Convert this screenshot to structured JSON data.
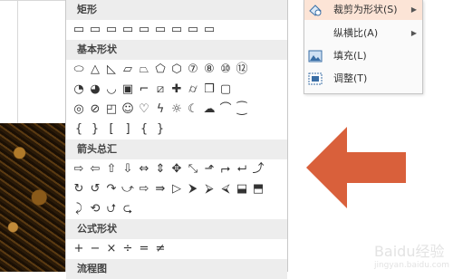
{
  "shape_panel": {
    "categories": {
      "rect": "矩形",
      "basic": "基本形状",
      "arrows": "箭头总汇",
      "equation": "公式形状",
      "flowchart": "流程图"
    },
    "rect_row": [
      "▭",
      "▭",
      "▭",
      "▭",
      "▭",
      "▭",
      "▭",
      "▭",
      "▭"
    ],
    "basic_row1": [
      "⬭",
      "△",
      "◺",
      "▱",
      "⏢",
      "⬠",
      "⬡",
      "⑦",
      "⑧",
      "⑩",
      "⑫"
    ],
    "basic_row2": [
      "◔",
      "◕",
      "◡",
      "▣",
      "⌐",
      "⧄",
      "✚",
      "⌭",
      "❒",
      "▢"
    ],
    "basic_row3": [
      "◎",
      "⊘",
      "◰",
      "☺",
      "♡",
      "ϟ",
      "☼",
      "☾",
      "☁",
      "⌒",
      "⁐"
    ],
    "basic_row4": [
      "{",
      "}",
      "[",
      "]",
      "{",
      "}"
    ],
    "arrows_row1": [
      "⇨",
      "⇦",
      "⇧",
      "⇩",
      "⇔",
      "⇕",
      "✥",
      "⤡",
      "⬏",
      "⮣",
      "⮠",
      "⤴"
    ],
    "arrows_row2": [
      "↻",
      "↺",
      "↷",
      "⤻",
      "⇨",
      "⇛",
      "▷",
      "⮞",
      "⮚",
      "⮘",
      "⬓",
      "⬒"
    ],
    "arrows_row3": [
      "⤸",
      "⟲",
      "⮍",
      "⮎"
    ],
    "equation_row": [
      "+",
      "−",
      "×",
      "÷",
      "=",
      "≠"
    ]
  },
  "context_menu": {
    "items": [
      {
        "label": "裁剪为形状(S)",
        "has_submenu": true,
        "highlighted": true,
        "icon": "crop-icon"
      },
      {
        "label": "纵横比(A)",
        "has_submenu": true,
        "highlighted": false,
        "icon": ""
      },
      {
        "label": "填充(L)",
        "has_submenu": false,
        "highlighted": false,
        "icon": "fill-icon"
      },
      {
        "label": "调整(T)",
        "has_submenu": false,
        "highlighted": false,
        "icon": "fit-icon"
      }
    ]
  },
  "colors": {
    "arrow": "#d9603b",
    "menu_highlight": "#fce4d6",
    "category_bg": "#ededed"
  },
  "watermark": {
    "text": "Baidu经验",
    "sub": "jingyan.baidu.com"
  }
}
